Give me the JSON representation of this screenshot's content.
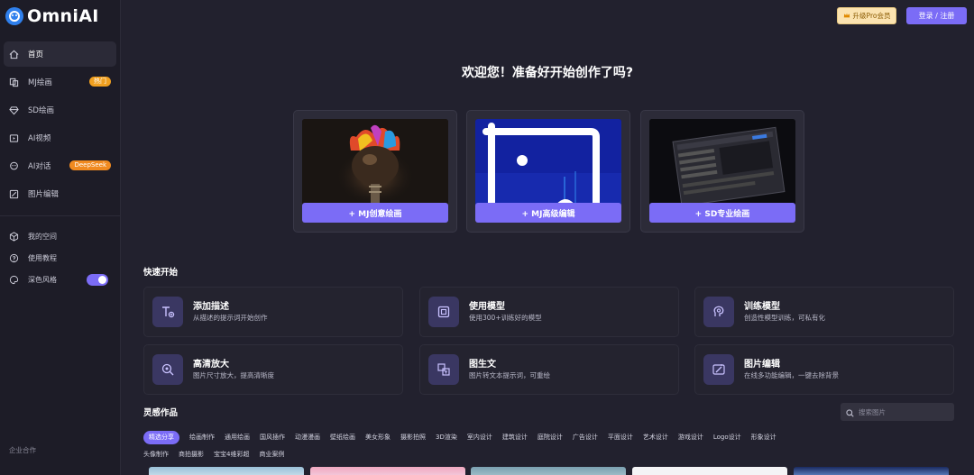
{
  "app": {
    "name": "OmniAI"
  },
  "sidebar": {
    "items": [
      {
        "label": "首页",
        "icon": "home-icon",
        "active": true
      },
      {
        "label": "MJ绘画",
        "icon": "mj-paint-icon",
        "badge": "热门",
        "badge_color": "#f0a020"
      },
      {
        "label": "SD绘画",
        "icon": "diamond-icon"
      },
      {
        "label": "AI视频",
        "icon": "video-icon"
      },
      {
        "label": "AI对话",
        "icon": "chat-icon",
        "badge": "DeepSeek",
        "badge_color": "#f08a20"
      },
      {
        "label": "图片编辑",
        "icon": "image-edit-icon"
      }
    ],
    "sub_items": [
      {
        "label": "我的空间",
        "icon": "cube-icon"
      },
      {
        "label": "使用教程",
        "icon": "help-icon"
      },
      {
        "label": "深色风格",
        "icon": "palette-icon",
        "toggle": true
      }
    ],
    "footer": "企业合作"
  },
  "header": {
    "pro_button": "升级Pro会员",
    "login_button": "登录 / 注册"
  },
  "headline": "欢迎您！准备好开始创作了吗?",
  "hero_cards": [
    {
      "label": "+ MJ创意绘画"
    },
    {
      "label": "+ MJ高级编辑"
    },
    {
      "label": "+ SD专业绘画"
    }
  ],
  "quick_start": {
    "title": "快速开始",
    "cards": [
      {
        "title": "添加描述",
        "desc": "从描述的提示词开始创作",
        "icon": "text-add-icon"
      },
      {
        "title": "使用模型",
        "desc": "使用300+训练好的模型",
        "icon": "model-icon"
      },
      {
        "title": "训练模型",
        "desc": "创造性模型训练，可私有化",
        "icon": "train-icon"
      },
      {
        "title": "高清放大",
        "desc": "图片尺寸放大，提高清晰度",
        "icon": "zoom-in-icon"
      },
      {
        "title": "图生文",
        "desc": "图片转文本提示词，可重绘",
        "icon": "image-to-text-icon"
      },
      {
        "title": "图片编辑",
        "desc": "在线多功能编辑，一键去除背景",
        "icon": "magic-edit-icon"
      }
    ]
  },
  "inspiration": {
    "title": "灵感作品",
    "search_placeholder": "搜索图片",
    "categories_row1": [
      "精选分享",
      "绘画制作",
      "通用绘画",
      "国风插作",
      "动漫漫画",
      "壁纸绘画",
      "美女形象",
      "摄影拍照",
      "3D渲染",
      "室内设计",
      "建筑设计",
      "庭院设计",
      "广告设计",
      "平面设计",
      "艺术设计",
      "游戏设计",
      "Logo设计",
      "形象设计"
    ],
    "categories_row2": [
      "头像制作",
      "商拍摄影",
      "宝宝4维彩超",
      "商业案例"
    ]
  },
  "colors": {
    "accent": "#7b6cf6",
    "background": "#22212e",
    "sidebar": "#1d1c27"
  }
}
